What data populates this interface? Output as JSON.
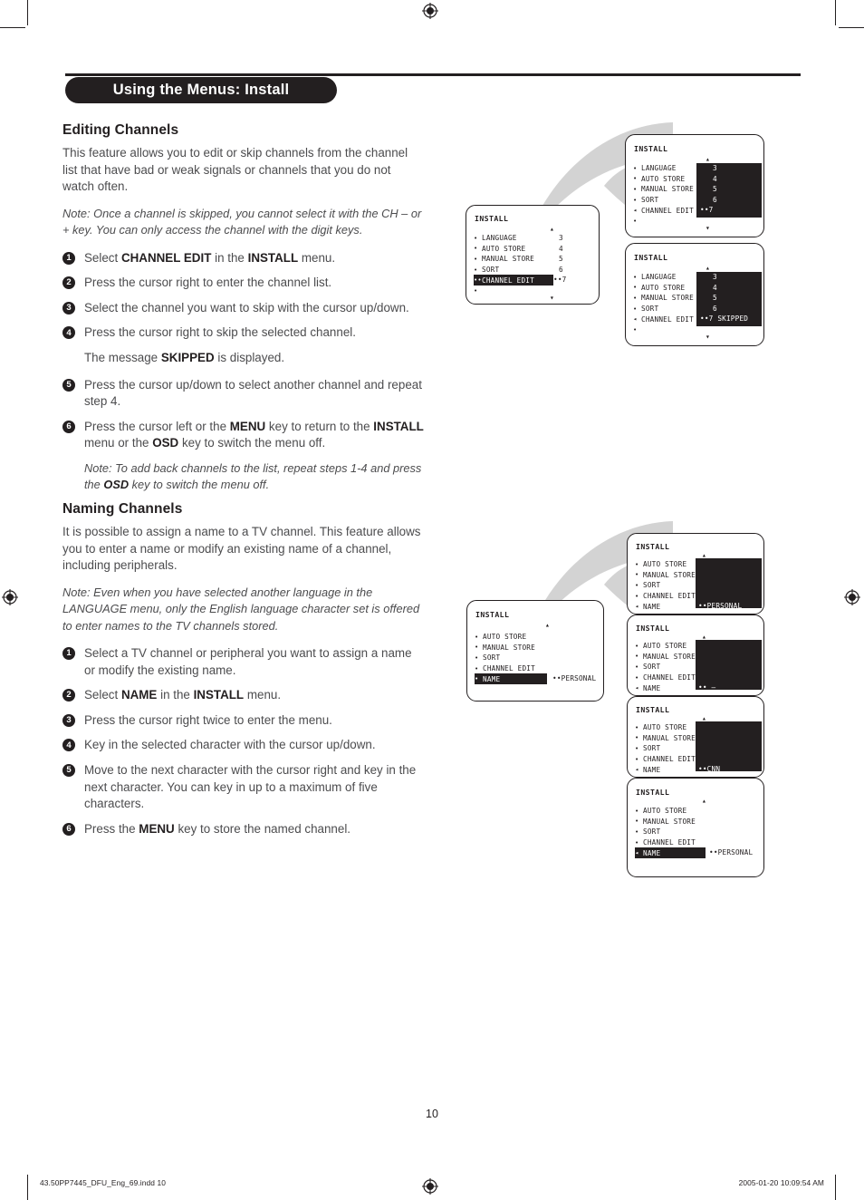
{
  "header": {
    "title": "Using the Menus: Install"
  },
  "sections": {
    "editing": {
      "heading": "Editing Channels",
      "intro": "This feature allows you to edit or skip channels from the channel list that have bad or weak signals or channels that you do not watch often.",
      "note": "Note: Once a channel is skipped, you cannot select it with the CH – or + key. You can only access the channel with the digit keys.",
      "steps": [
        "Select CHANNEL EDIT in the INSTALL menu.",
        "Press the cursor right to enter the channel list.",
        "Select the channel you want to skip with the cursor up/down.",
        "Press the cursor right to skip the selected channel.",
        "Press the cursor up/down to select another channel and repeat step 4.",
        "Press the cursor left or the MENU key to return to the INSTALL menu or the OSD key to switch the menu off."
      ],
      "substep": "The message SKIPPED is displayed.",
      "note2": "Note: To add back channels to the list, repeat steps 1-4 and press the OSD key to switch the menu off."
    },
    "naming": {
      "heading": "Naming Channels",
      "intro": "It is possible to assign a name to a TV channel. This feature allows you to enter a name or modify an existing name of a channel, including peripherals.",
      "note": "Note: Even when you have selected another language in the LANGUAGE menu, only the English language character set is offered to enter names to the TV channels stored.",
      "steps": [
        "Select a TV channel or peripheral you want to assign a name or modify the existing name.",
        "Select NAME in the INSTALL menu.",
        "Press the cursor right twice to enter the menu.",
        "Key in the selected character with the cursor up/down.",
        "Move to the next character with the cursor right and key in the next character. You can key in up to a maximum of five characters.",
        "Press the MENU key to store the named channel."
      ]
    }
  },
  "osd_screens": [
    {
      "id": "install-channel-edit-highlighted",
      "title": "INSTALL",
      "rows": [
        {
          "bullet": "•",
          "label": "LANGUAGE",
          "value": "3",
          "selected": false
        },
        {
          "bullet": "•",
          "label": "AUTO STORE",
          "value": "4",
          "selected": false
        },
        {
          "bullet": "•",
          "label": "MANUAL STORE",
          "value": "5",
          "selected": false
        },
        {
          "bullet": "•",
          "label": "SORT",
          "value": "6",
          "selected": false
        },
        {
          "bullet": "••",
          "label": "CHANNEL EDIT",
          "value": "••7",
          "selected": true
        },
        {
          "bullet": "•",
          "label": "",
          "value": "",
          "selected": false
        }
      ],
      "up_marker": "▴",
      "down_marker": "▾"
    },
    {
      "id": "install-channel-list-entered",
      "title": "INSTALL",
      "rows": [
        {
          "bullet": "•",
          "label": "LANGUAGE",
          "value": "3",
          "selected": false
        },
        {
          "bullet": "•",
          "label": "AUTO STORE",
          "value": "4",
          "selected": false
        },
        {
          "bullet": "•",
          "label": "MANUAL STORE",
          "value": "5",
          "selected": false
        },
        {
          "bullet": "•",
          "label": "SORT",
          "value": "6",
          "selected": false
        },
        {
          "bullet": "◂",
          "label": "CHANNEL EDIT",
          "value": "••7",
          "selected": false
        },
        {
          "bullet": "•",
          "label": "",
          "value": "",
          "selected": false
        }
      ],
      "panel": true,
      "up_marker": "▴",
      "down_marker": "▾"
    },
    {
      "id": "install-channel-skipped",
      "title": "INSTALL",
      "rows": [
        {
          "bullet": "•",
          "label": "LANGUAGE",
          "value": "3",
          "selected": false
        },
        {
          "bullet": "•",
          "label": "AUTO STORE",
          "value": "4",
          "selected": false
        },
        {
          "bullet": "•",
          "label": "MANUAL STORE",
          "value": "5",
          "selected": false
        },
        {
          "bullet": "•",
          "label": "SORT",
          "value": "6",
          "selected": false
        },
        {
          "bullet": "◂",
          "label": "CHANNEL EDIT",
          "value": "••7 SKIPPED",
          "selected": false
        },
        {
          "bullet": "•",
          "label": "",
          "value": "",
          "selected": false
        }
      ],
      "panel": true,
      "up_marker": "▴",
      "down_marker": "▾"
    },
    {
      "id": "install-name-personal-entered",
      "title": "INSTALL",
      "rows": [
        {
          "bullet": "•",
          "label": "AUTO STORE",
          "value": "",
          "selected": false
        },
        {
          "bullet": "•",
          "label": "MANUAL STORE",
          "value": "",
          "selected": false
        },
        {
          "bullet": "•",
          "label": "SORT",
          "value": "",
          "selected": false
        },
        {
          "bullet": "•",
          "label": "CHANNEL EDIT",
          "value": "",
          "selected": false
        },
        {
          "bullet": "◂",
          "label": "NAME",
          "value": "••PERSONAL",
          "selected": false
        }
      ],
      "panel": true,
      "up_marker": "▴"
    },
    {
      "id": "install-name-cursor",
      "title": "INSTALL",
      "rows": [
        {
          "bullet": "•",
          "label": "AUTO STORE",
          "value": "",
          "selected": false
        },
        {
          "bullet": "•",
          "label": "MANUAL STORE",
          "value": "",
          "selected": false
        },
        {
          "bullet": "•",
          "label": "SORT",
          "value": "",
          "selected": false
        },
        {
          "bullet": "•",
          "label": "CHANNEL EDIT",
          "value": "",
          "selected": false
        },
        {
          "bullet": "◂",
          "label": "NAME",
          "value": "•• –",
          "selected": false
        }
      ],
      "panel": true,
      "up_marker": "▴"
    },
    {
      "id": "install-name-cnn",
      "title": "INSTALL",
      "rows": [
        {
          "bullet": "•",
          "label": "AUTO STORE",
          "value": "",
          "selected": false
        },
        {
          "bullet": "•",
          "label": "MANUAL STORE",
          "value": "",
          "selected": false
        },
        {
          "bullet": "•",
          "label": "SORT",
          "value": "",
          "selected": false
        },
        {
          "bullet": "•",
          "label": "CHANNEL EDIT",
          "value": "",
          "selected": false
        },
        {
          "bullet": "◂",
          "label": "NAME",
          "value": "••CNN",
          "selected": false
        }
      ],
      "panel": true,
      "up_marker": "▴"
    },
    {
      "id": "install-name-stored",
      "title": "INSTALL",
      "rows": [
        {
          "bullet": "•",
          "label": "AUTO STORE",
          "value": "",
          "selected": false
        },
        {
          "bullet": "•",
          "label": "MANUAL STORE",
          "value": "",
          "selected": false
        },
        {
          "bullet": "•",
          "label": "SORT",
          "value": "",
          "selected": false
        },
        {
          "bullet": "•",
          "label": "CHANNEL EDIT",
          "value": "",
          "selected": false
        },
        {
          "bullet": "◂",
          "label": "NAME",
          "value": "••PERSONAL",
          "selected": true
        }
      ],
      "up_marker": "▴"
    },
    {
      "id": "install-name-highlighted",
      "title": "INSTALL",
      "rows": [
        {
          "bullet": "•",
          "label": "AUTO STORE",
          "value": "",
          "selected": false
        },
        {
          "bullet": "•",
          "label": "MANUAL STORE",
          "value": "",
          "selected": false
        },
        {
          "bullet": "•",
          "label": "SORT",
          "value": "",
          "selected": false
        },
        {
          "bullet": "•",
          "label": "CHANNEL EDIT",
          "value": "",
          "selected": false
        },
        {
          "bullet": "•",
          "label": "NAME",
          "value": "••PERSONAL",
          "selected": true
        }
      ],
      "up_marker": "▴"
    }
  ],
  "footer": {
    "page_number": "10",
    "filename": "43.50PP7445_DFU_Eng_69.indd   10",
    "timestamp": "2005-01-20   10:09:54 AM"
  },
  "colors": {
    "ink": "#231f20",
    "body_text": "#4c4c4e",
    "swoosh": "#d3d3d3"
  }
}
